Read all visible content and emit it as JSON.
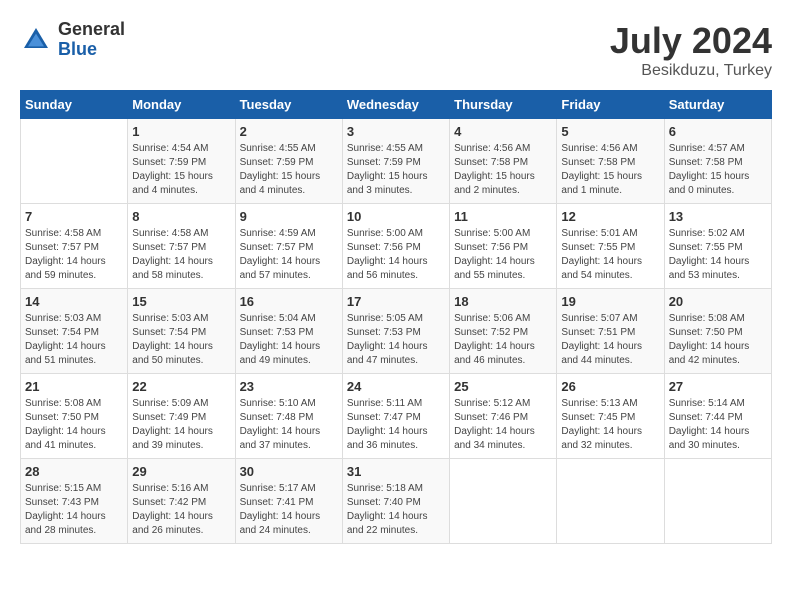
{
  "header": {
    "logo_general": "General",
    "logo_blue": "Blue",
    "title": "July 2024",
    "location": "Besikduzu, Turkey"
  },
  "weekdays": [
    "Sunday",
    "Monday",
    "Tuesday",
    "Wednesday",
    "Thursday",
    "Friday",
    "Saturday"
  ],
  "weeks": [
    [
      {
        "day": "",
        "sunrise": "",
        "sunset": "",
        "daylight": ""
      },
      {
        "day": "1",
        "sunrise": "Sunrise: 4:54 AM",
        "sunset": "Sunset: 7:59 PM",
        "daylight": "Daylight: 15 hours and 4 minutes."
      },
      {
        "day": "2",
        "sunrise": "Sunrise: 4:55 AM",
        "sunset": "Sunset: 7:59 PM",
        "daylight": "Daylight: 15 hours and 4 minutes."
      },
      {
        "day": "3",
        "sunrise": "Sunrise: 4:55 AM",
        "sunset": "Sunset: 7:59 PM",
        "daylight": "Daylight: 15 hours and 3 minutes."
      },
      {
        "day": "4",
        "sunrise": "Sunrise: 4:56 AM",
        "sunset": "Sunset: 7:58 PM",
        "daylight": "Daylight: 15 hours and 2 minutes."
      },
      {
        "day": "5",
        "sunrise": "Sunrise: 4:56 AM",
        "sunset": "Sunset: 7:58 PM",
        "daylight": "Daylight: 15 hours and 1 minute."
      },
      {
        "day": "6",
        "sunrise": "Sunrise: 4:57 AM",
        "sunset": "Sunset: 7:58 PM",
        "daylight": "Daylight: 15 hours and 0 minutes."
      }
    ],
    [
      {
        "day": "7",
        "sunrise": "Sunrise: 4:58 AM",
        "sunset": "Sunset: 7:57 PM",
        "daylight": "Daylight: 14 hours and 59 minutes."
      },
      {
        "day": "8",
        "sunrise": "Sunrise: 4:58 AM",
        "sunset": "Sunset: 7:57 PM",
        "daylight": "Daylight: 14 hours and 58 minutes."
      },
      {
        "day": "9",
        "sunrise": "Sunrise: 4:59 AM",
        "sunset": "Sunset: 7:57 PM",
        "daylight": "Daylight: 14 hours and 57 minutes."
      },
      {
        "day": "10",
        "sunrise": "Sunrise: 5:00 AM",
        "sunset": "Sunset: 7:56 PM",
        "daylight": "Daylight: 14 hours and 56 minutes."
      },
      {
        "day": "11",
        "sunrise": "Sunrise: 5:00 AM",
        "sunset": "Sunset: 7:56 PM",
        "daylight": "Daylight: 14 hours and 55 minutes."
      },
      {
        "day": "12",
        "sunrise": "Sunrise: 5:01 AM",
        "sunset": "Sunset: 7:55 PM",
        "daylight": "Daylight: 14 hours and 54 minutes."
      },
      {
        "day": "13",
        "sunrise": "Sunrise: 5:02 AM",
        "sunset": "Sunset: 7:55 PM",
        "daylight": "Daylight: 14 hours and 53 minutes."
      }
    ],
    [
      {
        "day": "14",
        "sunrise": "Sunrise: 5:03 AM",
        "sunset": "Sunset: 7:54 PM",
        "daylight": "Daylight: 14 hours and 51 minutes."
      },
      {
        "day": "15",
        "sunrise": "Sunrise: 5:03 AM",
        "sunset": "Sunset: 7:54 PM",
        "daylight": "Daylight: 14 hours and 50 minutes."
      },
      {
        "day": "16",
        "sunrise": "Sunrise: 5:04 AM",
        "sunset": "Sunset: 7:53 PM",
        "daylight": "Daylight: 14 hours and 49 minutes."
      },
      {
        "day": "17",
        "sunrise": "Sunrise: 5:05 AM",
        "sunset": "Sunset: 7:53 PM",
        "daylight": "Daylight: 14 hours and 47 minutes."
      },
      {
        "day": "18",
        "sunrise": "Sunrise: 5:06 AM",
        "sunset": "Sunset: 7:52 PM",
        "daylight": "Daylight: 14 hours and 46 minutes."
      },
      {
        "day": "19",
        "sunrise": "Sunrise: 5:07 AM",
        "sunset": "Sunset: 7:51 PM",
        "daylight": "Daylight: 14 hours and 44 minutes."
      },
      {
        "day": "20",
        "sunrise": "Sunrise: 5:08 AM",
        "sunset": "Sunset: 7:50 PM",
        "daylight": "Daylight: 14 hours and 42 minutes."
      }
    ],
    [
      {
        "day": "21",
        "sunrise": "Sunrise: 5:08 AM",
        "sunset": "Sunset: 7:50 PM",
        "daylight": "Daylight: 14 hours and 41 minutes."
      },
      {
        "day": "22",
        "sunrise": "Sunrise: 5:09 AM",
        "sunset": "Sunset: 7:49 PM",
        "daylight": "Daylight: 14 hours and 39 minutes."
      },
      {
        "day": "23",
        "sunrise": "Sunrise: 5:10 AM",
        "sunset": "Sunset: 7:48 PM",
        "daylight": "Daylight: 14 hours and 37 minutes."
      },
      {
        "day": "24",
        "sunrise": "Sunrise: 5:11 AM",
        "sunset": "Sunset: 7:47 PM",
        "daylight": "Daylight: 14 hours and 36 minutes."
      },
      {
        "day": "25",
        "sunrise": "Sunrise: 5:12 AM",
        "sunset": "Sunset: 7:46 PM",
        "daylight": "Daylight: 14 hours and 34 minutes."
      },
      {
        "day": "26",
        "sunrise": "Sunrise: 5:13 AM",
        "sunset": "Sunset: 7:45 PM",
        "daylight": "Daylight: 14 hours and 32 minutes."
      },
      {
        "day": "27",
        "sunrise": "Sunrise: 5:14 AM",
        "sunset": "Sunset: 7:44 PM",
        "daylight": "Daylight: 14 hours and 30 minutes."
      }
    ],
    [
      {
        "day": "28",
        "sunrise": "Sunrise: 5:15 AM",
        "sunset": "Sunset: 7:43 PM",
        "daylight": "Daylight: 14 hours and 28 minutes."
      },
      {
        "day": "29",
        "sunrise": "Sunrise: 5:16 AM",
        "sunset": "Sunset: 7:42 PM",
        "daylight": "Daylight: 14 hours and 26 minutes."
      },
      {
        "day": "30",
        "sunrise": "Sunrise: 5:17 AM",
        "sunset": "Sunset: 7:41 PM",
        "daylight": "Daylight: 14 hours and 24 minutes."
      },
      {
        "day": "31",
        "sunrise": "Sunrise: 5:18 AM",
        "sunset": "Sunset: 7:40 PM",
        "daylight": "Daylight: 14 hours and 22 minutes."
      },
      {
        "day": "",
        "sunrise": "",
        "sunset": "",
        "daylight": ""
      },
      {
        "day": "",
        "sunrise": "",
        "sunset": "",
        "daylight": ""
      },
      {
        "day": "",
        "sunrise": "",
        "sunset": "",
        "daylight": ""
      }
    ]
  ]
}
